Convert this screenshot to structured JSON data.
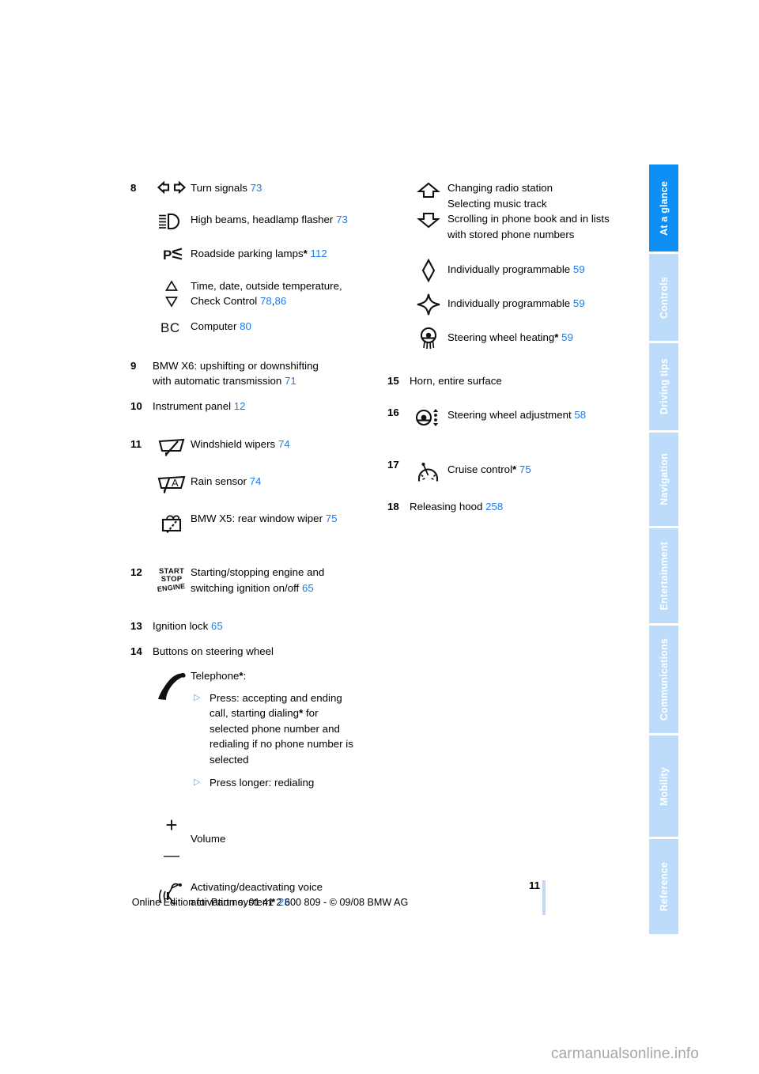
{
  "document": {
    "page_number": "11",
    "footer": "Online Edition for Part no. 01 41 2 600 809 - © 09/08 BMW AG",
    "watermark": "carmanualsonline.info",
    "accent_blue": "#1b7ced",
    "tab_active_blue": "#0d8ff5",
    "tab_inactive_blue": "#bcdcfa"
  },
  "tabs": [
    {
      "label": "At a glance",
      "active": true
    },
    {
      "label": "Controls",
      "active": false
    },
    {
      "label": "Driving tips",
      "active": false
    },
    {
      "label": "Navigation",
      "active": false
    },
    {
      "label": "Entertainment",
      "active": false
    },
    {
      "label": "Communications",
      "active": false
    },
    {
      "label": "Mobility",
      "active": false
    },
    {
      "label": "Reference",
      "active": false
    }
  ],
  "left_column": {
    "item_8": {
      "number": "8",
      "entries": [
        {
          "icon": "turn-signals-icon",
          "text": "Turn signals",
          "page": "73"
        },
        {
          "icon": "high-beams-icon",
          "text": "High beams, headlamp flasher",
          "page": "73"
        },
        {
          "icon": "roadside-parking-lamps-icon",
          "text": "Roadside parking lamps",
          "star": "*",
          "page": "112"
        },
        {
          "icon": "up-down-triangles-icon",
          "line1": "Time, date, outside temperature,",
          "line2": "Check Control",
          "page": "78",
          "page_separator": ",",
          "page2": "86"
        },
        {
          "icon": "bc-computer-icon",
          "text": "Computer",
          "page": "80"
        }
      ]
    },
    "item_9": {
      "number": "9",
      "line1": "BMW X6: upshifting or downshifting",
      "line2": "with automatic transmission",
      "page": "71"
    },
    "item_10": {
      "number": "10",
      "text": "Instrument panel",
      "page": "12"
    },
    "item_11": {
      "number": "11",
      "entries": [
        {
          "icon": "windshield-wipers-icon",
          "text": "Windshield wipers",
          "page": "74"
        },
        {
          "icon": "rain-sensor-icon",
          "text": "Rain sensor",
          "page": "74"
        },
        {
          "icon": "rear-window-wiper-icon",
          "text": "BMW X5: rear window wiper",
          "page": "75"
        }
      ]
    },
    "item_12": {
      "number": "12",
      "icon": "start-stop-engine-icon",
      "icon_text_line1": "START",
      "icon_text_line2": "STOP",
      "icon_text_line3": "ENGINE",
      "line1": "Starting/stopping engine and",
      "line2": "switching ignition on/off",
      "page": "65"
    },
    "item_13": {
      "number": "13",
      "text": "Ignition lock",
      "page": "65"
    },
    "item_14": {
      "number": "14",
      "text": "Buttons on steering wheel",
      "telephone": {
        "icon": "telephone-handset-icon",
        "label": "Telephone",
        "star": "*",
        "colon": ":",
        "bullets": [
          {
            "marker": "▷",
            "lines": [
              "Press: accepting and ending",
              "call, starting dialing",
              "selected phone number and",
              "redialing if no phone number is",
              "selected"
            ],
            "star_after_line2": "*",
            "line2_tail": " for"
          },
          {
            "marker": "▷",
            "lines": [
              "Press longer: redialing"
            ]
          }
        ]
      },
      "volume": {
        "icon": "volume-plus-minus-icon",
        "plus": "+",
        "minus": "—",
        "label": "Volume"
      },
      "voice": {
        "icon": "voice-activation-icon",
        "line1": "Activating/deactivating voice",
        "line2": "activation system",
        "star": "*",
        "page": "23"
      }
    }
  },
  "right_column": {
    "scroll_block": {
      "icon_up": "arrow-up-icon",
      "icon_down": "arrow-down-icon",
      "lines": [
        "Changing radio station",
        "Selecting music track",
        "Scrolling in phone book and in lists",
        "with stored phone numbers"
      ]
    },
    "programmable_1": {
      "icon": "diamond-outline-icon",
      "text": "Individually programmable",
      "page": "59"
    },
    "programmable_2": {
      "icon": "four-point-star-icon",
      "text": "Individually programmable",
      "page": "59"
    },
    "steering_wheel_heating": {
      "icon": "steering-wheel-heating-icon",
      "text": "Steering wheel heating",
      "star": "*",
      "page": "59"
    },
    "item_15": {
      "number": "15",
      "text": "Horn, entire surface"
    },
    "item_16": {
      "number": "16",
      "icon": "steering-wheel-adjustment-icon",
      "text": "Steering wheel adjustment",
      "page": "58"
    },
    "item_17": {
      "number": "17",
      "icon": "cruise-control-icon",
      "text": "Cruise control",
      "star": "*",
      "page": "75"
    },
    "item_18": {
      "number": "18",
      "text": "Releasing hood",
      "page": "258"
    }
  }
}
